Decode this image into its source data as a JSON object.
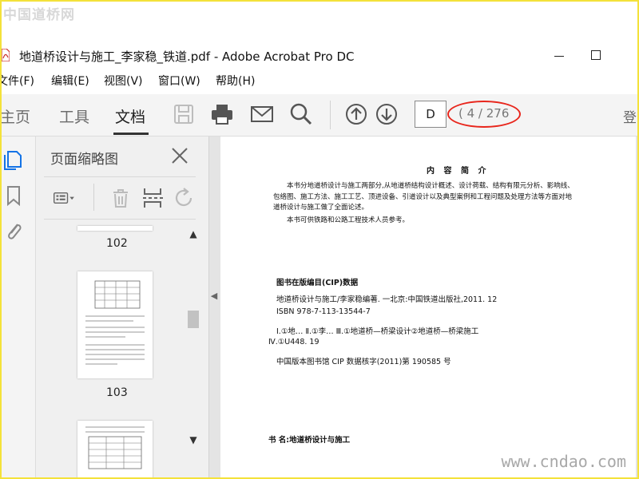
{
  "watermark": {
    "top": "中国道桥网",
    "bottom": "www.cndao.com"
  },
  "window": {
    "title": "地道桥设计与施工_李家稳_铁道.pdf - Adobe Acrobat Pro DC"
  },
  "menu": {
    "items": [
      "文件(F)",
      "编辑(E)",
      "视图(V)",
      "窗口(W)",
      "帮助(H)"
    ]
  },
  "toolbar": {
    "tabs": [
      "主页",
      "工具",
      "文档"
    ],
    "active_tab": "文档",
    "page_input": "D",
    "page_count": "( 4 / 276",
    "cut_text": "登"
  },
  "thumbnails": {
    "title": "页面缩略图",
    "labels": [
      "102",
      "103"
    ]
  },
  "document": {
    "heading": "内 容 简 介",
    "para1": "本书分地道桥设计与施工两部分,从地道桥结构设计概述、设计荷载、结构有限元分析、影响线、包络图、施工方法、施工工艺、顶进设备、引道设计以及典型案例和工程问题及处理方法等方面对地道桥设计与施工做了全面论述。",
    "para2": "本书可供铁路和公路工程技术人员参考。",
    "cip_heading": "图书在版编目(CIP)数据",
    "cip_lines": [
      "地道桥设计与施工/李家稳编著. 一北京:中国铁道出版社,2011. 12",
      "ISBN 978-7-113-13544-7",
      "Ⅰ.①地…   Ⅱ.①李…   Ⅲ.①地道桥—桥梁设计②地道桥—桥梁施工",
      "Ⅳ.①U448. 19",
      "中国版本图书馆 CIP 数据核字(2011)第 190585 号"
    ],
    "book_line": "书    名:地道桥设计与施工"
  },
  "colors": {
    "highlight": "#e8261c",
    "frame": "#f4e23a"
  }
}
